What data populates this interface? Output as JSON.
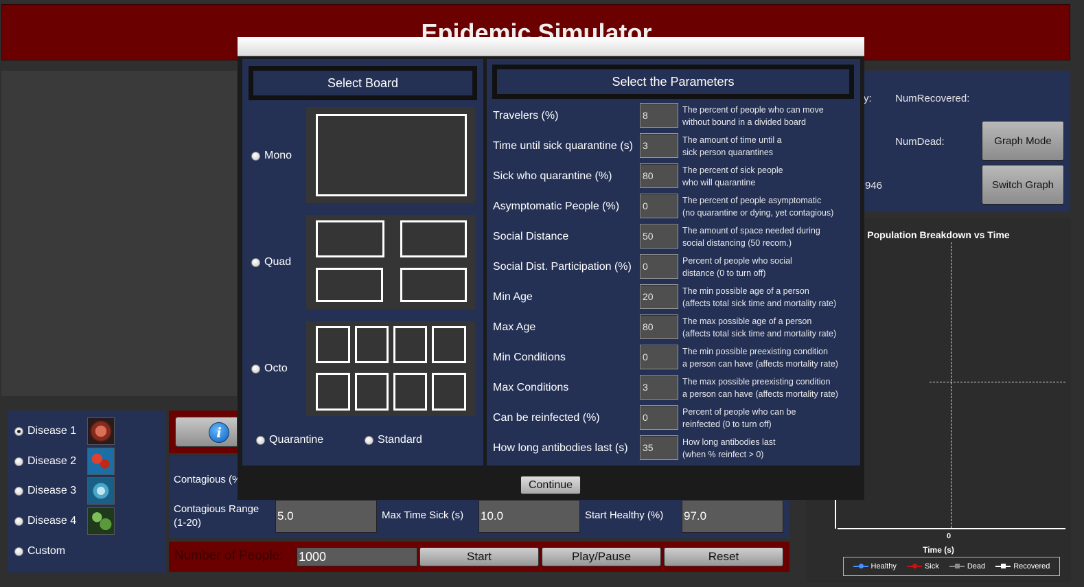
{
  "app": {
    "title": "Epidemic Simulator"
  },
  "stats": {
    "num_recovered_label": "NumRecovered:",
    "num_dead_label": "NumDead:",
    "partial_top_label": "y:",
    "partial_value": "946"
  },
  "side_buttons": {
    "graph_mode": "Graph Mode",
    "switch_graph": "Switch Graph"
  },
  "graph": {
    "title": "Population Breakdown vs Time",
    "x_label": "Time (s)",
    "x_tick": "0",
    "legend": [
      {
        "name": "Healthy",
        "color": "#4a90ff"
      },
      {
        "name": "Sick",
        "color": "#d01010"
      },
      {
        "name": "Dead",
        "color": "#8a8a8a"
      },
      {
        "name": "Recovered",
        "color": "#ffffff"
      }
    ]
  },
  "diseases": {
    "items": [
      {
        "label": "Disease 1",
        "selected": true,
        "icon": "virus-red-icon"
      },
      {
        "label": "Disease 2",
        "selected": false,
        "icon": "virus-cells-icon"
      },
      {
        "label": "Disease 3",
        "selected": false,
        "icon": "virus-blue-icon"
      },
      {
        "label": "Disease 4",
        "selected": false,
        "icon": "virus-green-icon"
      },
      {
        "label": "Custom",
        "selected": false
      }
    ]
  },
  "disease_params": {
    "contagious_label": "Contagious (%",
    "contagious_range_label": "Contagious Range (1-20)",
    "contagious_range_value": "5.0",
    "max_time_sick_label": "Max Time Sick (s)",
    "max_time_sick_value": "10.0",
    "start_healthy_label": "Start Healthy (%)",
    "start_healthy_value": "97.0"
  },
  "bottom_bar": {
    "people_label": "Number of People:",
    "people_value": "1000",
    "start": "Start",
    "play_pause": "Play/Pause",
    "reset": "Reset"
  },
  "dialog": {
    "board_header": "Select Board",
    "boards": [
      {
        "label": "Mono",
        "selected": false
      },
      {
        "label": "Quad",
        "selected": false
      },
      {
        "label": "Octo",
        "selected": false
      }
    ],
    "modes": [
      {
        "label": "Quarantine",
        "selected": false
      },
      {
        "label": "Standard",
        "selected": false
      }
    ],
    "params_header": "Select the Parameters",
    "params": [
      {
        "label": "Travelers (%)",
        "value": "8",
        "desc1": "The percent of people who can move",
        "desc2": "without bound in a divided board"
      },
      {
        "label": "Time until sick quarantine (s)",
        "value": "3",
        "desc1": "The amount of time until a",
        "desc2": "sick person quarantines"
      },
      {
        "label": "Sick who quarantine (%)",
        "value": "80",
        "desc1": "The percent of sick people",
        "desc2": "who will quarantine"
      },
      {
        "label": "Asymptomatic People (%)",
        "value": "0",
        "desc1": "The percent of people asymptomatic",
        "desc2": "(no quarantine or dying, yet contagious)"
      },
      {
        "label": "Social Distance",
        "value": "50",
        "desc1": "The amount of space needed during",
        "desc2": "social distancing (50 recom.)"
      },
      {
        "label": "Social Dist. Participation (%)",
        "value": "0",
        "desc1": "Percent of people who social",
        "desc2": "distance (0 to turn off)"
      },
      {
        "label": "Min Age",
        "value": "20",
        "desc1": "The min possible age of a person",
        "desc2": "(affects total sick time and mortality rate)"
      },
      {
        "label": "Max Age",
        "value": "80",
        "desc1": "The max possible age of a person",
        "desc2": "(affects total sick time and mortality rate)"
      },
      {
        "label": "Min Conditions",
        "value": "0",
        "desc1": "The min possible preexisting condition",
        "desc2": "a person can have (affects mortality rate)"
      },
      {
        "label": "Max Conditions",
        "value": "3",
        "desc1": "The max possible preexisting condition",
        "desc2": "a person can have (affects mortality rate)"
      },
      {
        "label": "Can be reinfected (%)",
        "value": "0",
        "desc1": "Percent of people who can be",
        "desc2": "reinfected (0 to turn off)"
      },
      {
        "label": "How long antibodies last (s)",
        "value": "35",
        "desc1": "How long antibodies last",
        "desc2": "(when % reinfect > 0)"
      }
    ],
    "continue": "Continue"
  }
}
